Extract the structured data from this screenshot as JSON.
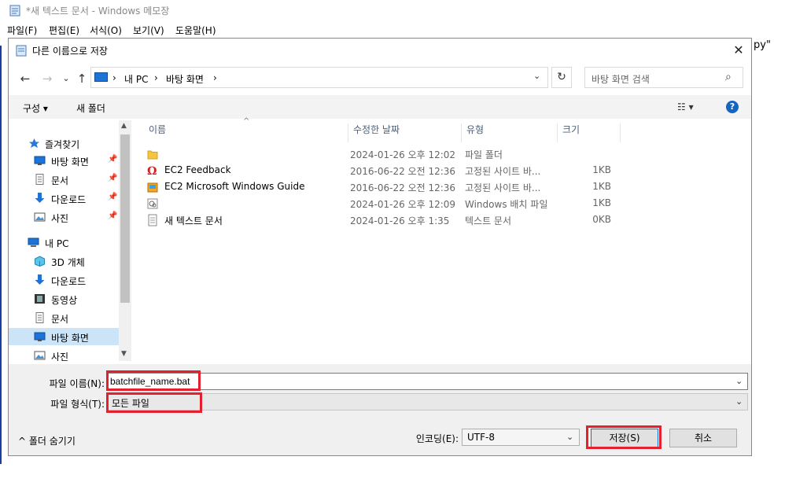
{
  "notepad": {
    "title": "*새 텍스트 문서 - Windows 메모장",
    "menu": [
      "파일(F)",
      "편집(E)",
      "서식(O)",
      "보기(V)",
      "도움말(H)"
    ],
    "text_snippet": "py\""
  },
  "dialog": {
    "title": "다른 이름으로 저장",
    "close": "✕",
    "nav": {
      "back": "←",
      "forward": "→",
      "recent": "⌄",
      "up": "↑"
    },
    "address": {
      "crumbs": [
        "내 PC",
        "바탕 화면"
      ],
      "sep": "›",
      "refresh": "↻"
    },
    "search": {
      "placeholder": "바탕 화면 검색",
      "icon": "⌕"
    },
    "toolbar": {
      "organize": "구성 ▾",
      "new_folder": "새 폴더",
      "view": "☷ ▾",
      "help": "?"
    },
    "navpane": {
      "items": [
        {
          "label": "즐겨찾기",
          "icon": "star-icon"
        },
        {
          "label": "바탕 화면",
          "icon": "desktop-icon",
          "pinned": true
        },
        {
          "label": "문서",
          "icon": "document-icon",
          "pinned": true
        },
        {
          "label": "다운로드",
          "icon": "download-icon",
          "pinned": true
        },
        {
          "label": "사진",
          "icon": "picture-icon",
          "pinned": true
        },
        {
          "label": "내 PC",
          "icon": "computer-icon"
        },
        {
          "label": "3D 개체",
          "icon": "cube-icon"
        },
        {
          "label": "다운로드",
          "icon": "download-icon"
        },
        {
          "label": "동영상",
          "icon": "video-icon"
        },
        {
          "label": "문서",
          "icon": "document-icon"
        },
        {
          "label": "바탕 화면",
          "icon": "desktop-icon",
          "selected": true
        },
        {
          "label": "사진",
          "icon": "picture-icon"
        }
      ],
      "pin": "📌"
    },
    "filelist": {
      "sort_indicator": "^",
      "columns": [
        "이름",
        "수정한 날짜",
        "유형",
        "크기"
      ],
      "rows": [
        {
          "name": "",
          "date": "2024-01-26 오후 12:02",
          "type": "파일 폴더",
          "size": "",
          "icon": "folder-icon"
        },
        {
          "name": "EC2 Feedback",
          "date": "2016-06-22 오전 12:36",
          "type": "고정된 사이트 바...",
          "size": "1KB",
          "icon": "feedback-icon"
        },
        {
          "name": "EC2 Microsoft Windows Guide",
          "date": "2016-06-22 오전 12:36",
          "type": "고정된 사이트 바...",
          "size": "1KB",
          "icon": "guide-icon"
        },
        {
          "name": "",
          "date": "2024-01-26 오후 12:09",
          "type": "Windows 배치 파일",
          "size": "1KB",
          "icon": "batch-file-icon"
        },
        {
          "name": "새 텍스트 문서",
          "date": "2024-01-26 오후 1:35",
          "type": "텍스트 문서",
          "size": "0KB",
          "icon": "text-file-icon"
        }
      ]
    },
    "filename": {
      "label": "파일 이름(N):",
      "value": "batchfile_name.bat"
    },
    "filetype": {
      "label": "파일 형식(T):",
      "value": "모든 파일"
    },
    "hide_folders": "^ 폴더 숨기기",
    "encoding": {
      "label": "인코딩(E):",
      "value": "UTF-8"
    },
    "save": "저장(S)",
    "cancel": "취소",
    "dropdown_arrow": "⌄",
    "highlight_color": "#e5202e"
  }
}
